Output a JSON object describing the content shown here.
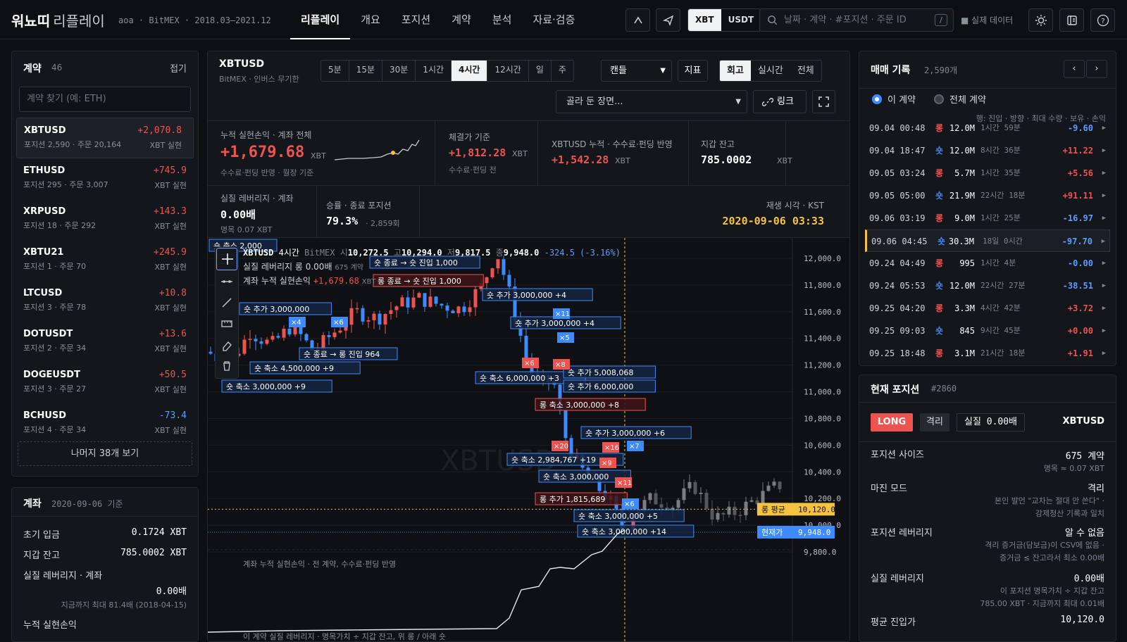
{
  "app": {
    "brand": "워뇨띠",
    "brand_sub": "리플레이",
    "meta": "aoa · BitMEX · 2018.03–2021.12"
  },
  "nav": [
    "리플레이",
    "개요",
    "포지션",
    "계약",
    "분석",
    "자료·검증"
  ],
  "currency": {
    "a": "XBT",
    "b": "USDT"
  },
  "search": {
    "placeholder": "날짜 · 계약 · #포지션 · 주문 ID",
    "kbd": "/"
  },
  "real_data": "■ 실제 데이터",
  "contracts": {
    "title": "계약",
    "count": "46",
    "collapse": "접기",
    "search_placeholder": "계약 찾기 (예: ETH)",
    "more": "나머지 38개 보기",
    "items": [
      {
        "sym": "XBTUSD",
        "sub": "포지션 2,590 · 주문 20,164",
        "val": "+2,070.8",
        "unit": "XBT 실현",
        "dir": "pos"
      },
      {
        "sym": "ETHUSD",
        "sub": "포지션 295 · 주문 3,007",
        "val": "+745.9",
        "unit": "XBT 실현",
        "dir": "pos"
      },
      {
        "sym": "XRPUSD",
        "sub": "포지션 18 · 주문 292",
        "val": "+143.3",
        "unit": "XBT 실현",
        "dir": "pos"
      },
      {
        "sym": "XBTU21",
        "sub": "포지션 1 · 주문 70",
        "val": "+245.9",
        "unit": "XBT 실현",
        "dir": "pos"
      },
      {
        "sym": "LTCUSD",
        "sub": "포지션 3 · 주문 78",
        "val": "+10.8",
        "unit": "XBT 실현",
        "dir": "pos"
      },
      {
        "sym": "DOTUSDT",
        "sub": "포지션 2 · 주문 34",
        "val": "+13.6",
        "unit": "XBT 실현",
        "dir": "pos"
      },
      {
        "sym": "DOGEUSDT",
        "sub": "포지션 3 · 주문 27",
        "val": "+50.5",
        "unit": "XBT 실현",
        "dir": "pos"
      },
      {
        "sym": "BCHUSD",
        "sub": "포지션 4 · 주문 34",
        "val": "-73.4",
        "unit": "XBT 실현",
        "dir": "neg"
      }
    ]
  },
  "account": {
    "title": "계좌",
    "date": "2020-09-06 기준",
    "initial_label": "초기 입금",
    "initial": "0.1724 XBT",
    "wallet_label": "지갑 잔고",
    "wallet": "785.0002 XBT",
    "lev_label": "실질 레버리지 · 계좌",
    "lev": "0.00배",
    "lev_note": "지금까지 최대 81.4배 (2018-04-15)",
    "cum_label": "누적 실현손익"
  },
  "chart_header": {
    "symbol": "XBTUSD",
    "desc": "BitMEX · 인버스 무기한",
    "timeframes": [
      "5분",
      "15분",
      "30분",
      "1시간",
      "4시간",
      "12시간",
      "일",
      "주"
    ],
    "active_tf": "4시간",
    "chart_type": "캔들",
    "indicators": "지표",
    "modes": [
      "회고",
      "실시간",
      "전체"
    ],
    "active_mode": "회고",
    "scene_placeholder": "골라 둔 장면...",
    "link": "링크"
  },
  "stats": {
    "cum_label": "누적 실현손익 · 계좌 전체",
    "cum_value": "+1,679.68",
    "cum_unit": "XBT",
    "cum_note": "수수료·펀딩 반영 · 월장 기준",
    "fill_label": "체결가 기준",
    "fill_value": "+1,812.28",
    "fill_unit": "XBT",
    "fill_note": "수수료·펀딩 전",
    "sym_label": "XBTUSD 누적 · 수수료·펀딩 반영",
    "sym_value": "+1,542.28",
    "sym_unit": "XBT",
    "wallet_label": "지갑 잔고",
    "wallet_value": "785.0002",
    "wallet_unit": "XBT",
    "lev_label": "실질 레버리지 · 계좌",
    "lev_value": "0.00배",
    "lev_note": "명목 0.07 XBT",
    "win_label": "승률 · 종료 포지션",
    "win_value": "79.3%",
    "win_note": "· 2,859회",
    "play_label": "재생 시각 · KST",
    "play_value": "2020-09-06 03:33"
  },
  "ohlc": {
    "sym": "XBTUSD",
    "tf": "4시간",
    "ex": "BitMEX",
    "o_l": "시",
    "o": "10,272.5",
    "h_l": "고",
    "h": "10,294.0",
    "l_l": "저",
    "l": "9,817.5",
    "c_l": "종",
    "c": "9,948.0",
    "chg": "-324.5 (-3.16%)"
  },
  "legend": {
    "lev": "실질 레버리지 롱 0.00배",
    "lev_note": "675 계약",
    "cum": "계좌 누적 실현손익",
    "cum_val": "+1,679.68",
    "cum_unit": "XBT",
    "sub_pnl_caption": "계좌 누적 실현손익 · 전 계약, 수수료·펀딩 반영",
    "sub_lev_caption": "이 계약 실질 레버리지 · 명목가치 ÷ 지갑 잔고, 위 롱 / 아래 숏",
    "watermark": "XBTUSD"
  },
  "axis": {
    "ticks": [
      "12,000.0",
      "11,800.0",
      "11,600.0",
      "11,400.0",
      "11,200.0",
      "11,000.0",
      "10,800.0",
      "10,600.0",
      "10,400.0",
      "10,200.0",
      "10,000.0",
      "9,800.0"
    ],
    "avg_label": "롱 평균",
    "avg_value": "10,120.0",
    "cur_label": "현재가",
    "cur_value": "9,948.0"
  },
  "annotations": [
    "숏 축소 2,000",
    "숏 종료 → 숏 진입 1,000",
    "롱 종료 → 숏 진입 1,000",
    "숏 추가 3,000,000",
    "숏 추가 3,000,000 +4",
    "숏 추가 3,000,000 +4",
    "숏 종료 → 롱 진입 964",
    "숏 축소 4,500,000 +9",
    "숏 축소 3,000,000 +9",
    "숏 축소 6,000,000 +3",
    "숏 추가 5,008,068",
    "숏 추가 6,000,000",
    "롱 축소 3,000,000 +8",
    "숏 추가 3,000,000 +6",
    "숏 축소 2,984,767 +19",
    "숏 축소 3,000,000",
    "롱 추가 1,815,689",
    "숏 축소 3,000,000 +5",
    "숏 축소 3,000,000 +14"
  ],
  "markers": [
    "×6",
    "×11",
    "×5",
    "×8",
    "×6",
    "×20",
    "×16",
    "×7",
    "×11",
    "×6",
    "×9",
    "×4"
  ],
  "chart_data": {
    "type": "candlestick",
    "series_note": "XBTUSD 4시간",
    "last": {
      "open": 10272.5,
      "high": 10294.0,
      "low": 9817.5,
      "close": 9948.0
    },
    "ylim": [
      9700,
      12100
    ],
    "avg_entry": 10120.0,
    "current": 9948.0
  },
  "trades": {
    "title": "매매 기록",
    "count": "2,590개",
    "filter_this": "이 계약",
    "filter_all": "전체 계약",
    "cols": "행: 진입 · 방향 · 최대 수량 · 보유 · 손익",
    "rows": [
      {
        "t": "09.04 00:48",
        "d": "롱",
        "q": "12.0M",
        "h": "1시간 59분",
        "p": "-9.60",
        "dir": "neg"
      },
      {
        "t": "09.04 18:47",
        "d": "숏",
        "q": "12.0M",
        "h": "8시간 36분",
        "p": "+11.22",
        "dir": "pos"
      },
      {
        "t": "09.05 03:24",
        "d": "롱",
        "q": "5.7M",
        "h": "1시간 35분",
        "p": "+5.56",
        "dir": "pos"
      },
      {
        "t": "09.05 05:00",
        "d": "숏",
        "q": "21.9M",
        "h": "22시간 18분",
        "p": "+91.11",
        "dir": "pos"
      },
      {
        "t": "09.06 03:19",
        "d": "롱",
        "q": "9.0M",
        "h": "1시간 25분",
        "p": "-16.97",
        "dir": "neg"
      },
      {
        "t": "09.06 04:45",
        "d": "숏",
        "q": "30.3M",
        "h": "18일 0시간",
        "p": "-97.70",
        "dir": "neg"
      },
      {
        "t": "09.24 04:49",
        "d": "롱",
        "q": "995",
        "h": "1시간 4분",
        "p": "-0.00",
        "dir": "neg"
      },
      {
        "t": "09.24 05:53",
        "d": "숏",
        "q": "12.0M",
        "h": "22시간 27분",
        "p": "-38.51",
        "dir": "neg"
      },
      {
        "t": "09.25 04:20",
        "d": "롱",
        "q": "3.3M",
        "h": "4시간 42분",
        "p": "+3.72",
        "dir": "pos"
      },
      {
        "t": "09.25 09:03",
        "d": "숏",
        "q": "845",
        "h": "9시간 45분",
        "p": "+0.00",
        "dir": "pos"
      },
      {
        "t": "09.25 18:48",
        "d": "롱",
        "q": "3.1M",
        "h": "21시간 18분",
        "p": "+1.91",
        "dir": "pos"
      }
    ]
  },
  "position": {
    "title": "현재 포지션",
    "id": "#2860",
    "side": "LONG",
    "margin_tag": "격리",
    "lev_tag": "실질 0.00배",
    "sym": "XBTUSD",
    "size_label": "포지션 사이즈",
    "size": "675 계약",
    "size_note": "명목 ≈ 0.07 XBT",
    "mode_label": "마진 모드",
    "mode": "격리",
    "mode_note1": "본인 발언 \"교차는 절대 안 쓴다\" ·",
    "mode_note2": "강제청산 기록과 일치",
    "plev_label": "포지션 레버리지",
    "plev": "알 수 없음",
    "plev_note1": "격리 증거금(담보금)이 CSV에 없음 ·",
    "plev_note2": "증거금 ≤ 잔고라서 최소 0.00배",
    "rlev_label": "실질 레버리지",
    "rlev": "0.00배",
    "rlev_note1": "이 포지션 명목가치 ÷ 지갑 잔고",
    "rlev_note2": "785.00 XBT · 지금까지 최대 0.01배",
    "avg_label": "평균 진입가",
    "avg": "10,120.0"
  },
  "colors": {
    "up": "#ef5350",
    "down": "#3d8bff",
    "accent": "#f5c242"
  }
}
